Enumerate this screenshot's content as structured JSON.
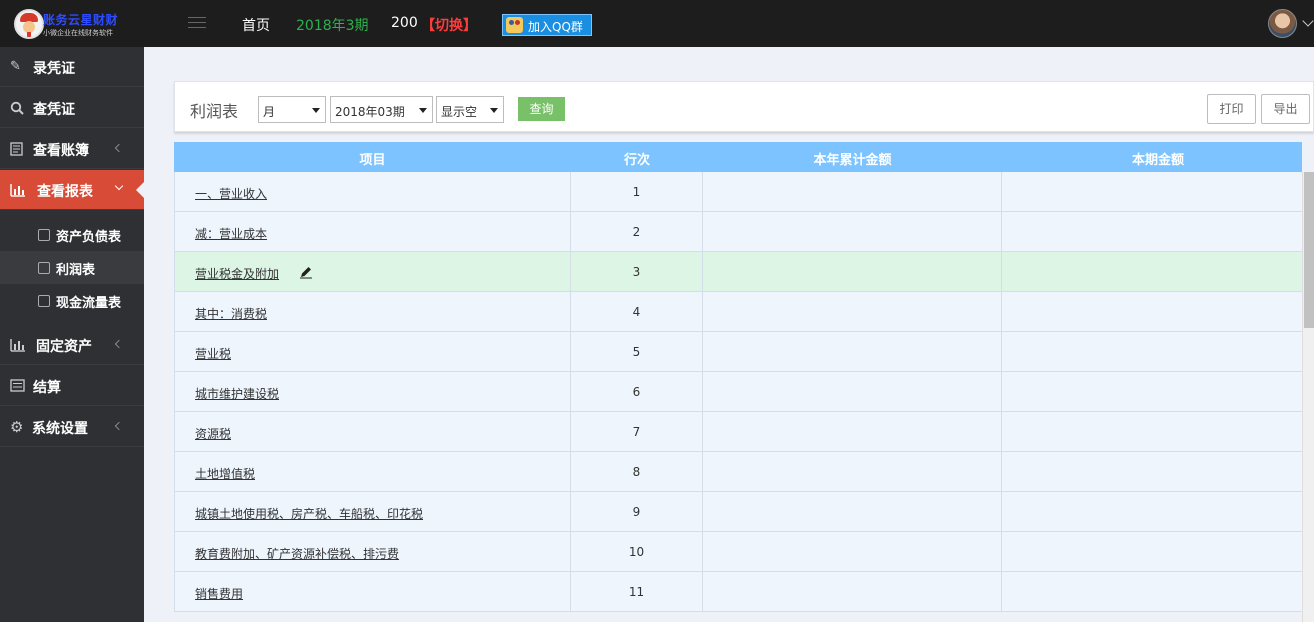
{
  "app": {
    "logo_title": "账务云星财财",
    "logo_subtitle": "小微企业在线财务软件",
    "colors": {
      "topbar": "#1d1d1d",
      "sidebar": "#2f3033",
      "active": "#d84b37",
      "table_header": "#7cc3ff",
      "query_btn": "#79c168",
      "period_green": "#2bb24c",
      "switch_red": "#ff3b3b"
    }
  },
  "header": {
    "home": "首页",
    "period": "2018年3期",
    "count": "200",
    "switch": "【切换】",
    "qq_group": "加入QQ群"
  },
  "sidebar": {
    "items": [
      {
        "label": "录凭证",
        "icon": "edit-icon"
      },
      {
        "label": "查凭证",
        "icon": "search-icon"
      },
      {
        "label": "查看账簿",
        "icon": "ledger-icon"
      },
      {
        "label": "查看报表",
        "icon": "bar-chart-icon"
      },
      {
        "label": "固定资产",
        "icon": "bar-chart-icon"
      },
      {
        "label": "结算",
        "icon": "list-icon"
      },
      {
        "label": "系统设置",
        "icon": "gear-icon"
      }
    ],
    "sub_items": [
      {
        "label": "资产负债表"
      },
      {
        "label": "利润表"
      },
      {
        "label": "现金流量表"
      }
    ]
  },
  "toolbar": {
    "title": "利润表",
    "period_type": "月",
    "period": "2018年03期",
    "show_empty": "显示空",
    "query": "查询",
    "print": "打印",
    "export": "导出"
  },
  "table": {
    "columns": [
      "项目",
      "行次",
      "本年累计金额",
      "本期金额"
    ],
    "rows": [
      {
        "item": "一、营业收入",
        "line": "1"
      },
      {
        "item": "减：营业成本",
        "line": "2"
      },
      {
        "item": "营业税金及附加",
        "line": "3"
      },
      {
        "item": "其中：消费税",
        "line": "4"
      },
      {
        "item": "营业税",
        "line": "5"
      },
      {
        "item": "城市维护建设税",
        "line": "6"
      },
      {
        "item": "资源税",
        "line": "7"
      },
      {
        "item": "土地增值税",
        "line": "8"
      },
      {
        "item": "城镇土地使用税、房产税、车船税、印花税",
        "line": "9"
      },
      {
        "item": "教育费附加、矿产资源补偿税、排污费",
        "line": "10"
      },
      {
        "item": "销售费用",
        "line": "11"
      }
    ]
  }
}
